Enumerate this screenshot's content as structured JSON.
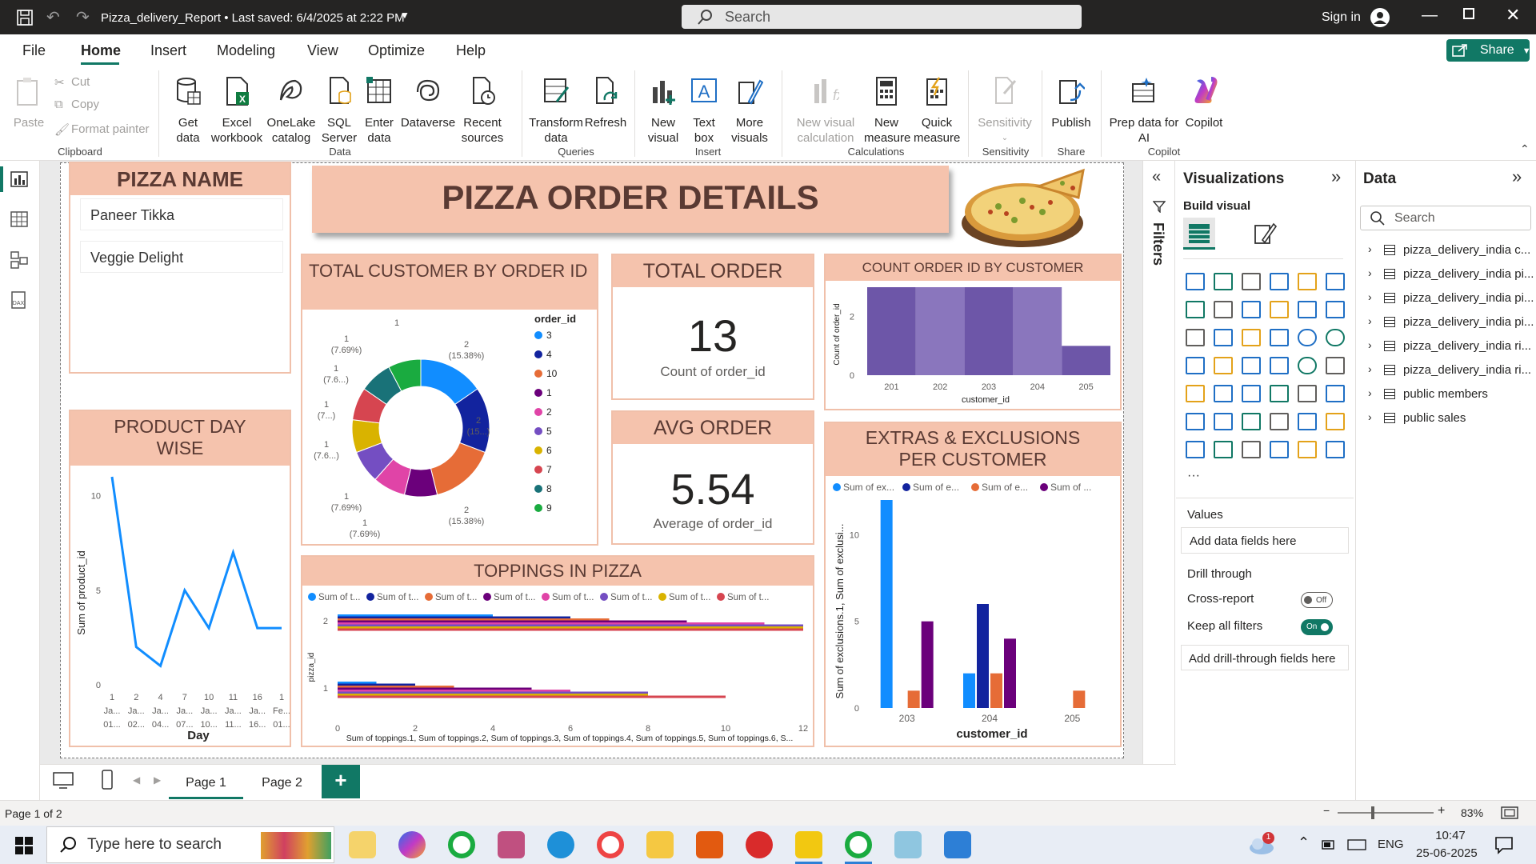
{
  "titlebar": {
    "title": "Pizza_delivery_Report • Last saved: 6/4/2025 at 2:22 PM",
    "search_placeholder": "Search",
    "signin": "Sign in"
  },
  "menu": {
    "items": [
      "File",
      "Home",
      "Insert",
      "Modeling",
      "View",
      "Optimize",
      "Help"
    ],
    "share": "Share"
  },
  "ribbon": {
    "clipboard": {
      "paste": "Paste",
      "cut": "Cut",
      "copy": "Copy",
      "format_painter": "Format painter",
      "group": "Clipboard"
    },
    "data": {
      "get_data": "Get data",
      "excel": "Excel workbook",
      "onelake": "OneLake catalog",
      "sql": "SQL Server",
      "enter": "Enter data",
      "dataverse": "Dataverse",
      "recent": "Recent sources",
      "group": "Data"
    },
    "queries": {
      "transform": "Transform data",
      "refresh": "Refresh",
      "group": "Queries"
    },
    "insert": {
      "new_visual": "New visual",
      "text_box": "Text box",
      "more_visuals": "More visuals",
      "group": "Insert"
    },
    "calculations": {
      "new_visual_calc": "New visual calculation",
      "new_measure": "New measure",
      "quick_measure": "Quick measure",
      "group": "Calculations"
    },
    "sensitivity": {
      "label": "Sensitivity",
      "group": "Sensitivity"
    },
    "share": {
      "publish": "Publish",
      "group": "Share"
    },
    "copilot": {
      "prep": "Prep data for AI",
      "copilot": "Copilot",
      "group": "Copilot"
    }
  },
  "report": {
    "title": "PIZZA ORDER DETAILS",
    "pizza_name": {
      "header": "PIZZA NAME",
      "items": [
        "Paneer Tikka",
        "Veggie Delight"
      ]
    },
    "product_day": {
      "header": "PRODUCT DAY WISE",
      "ylabel": "Sum of product_id",
      "xlabel": "Day"
    },
    "donut": {
      "header": "TOTAL CUSTOMER BY ORDER ID",
      "legend_title": "order_id"
    },
    "total_order": {
      "header": "TOTAL ORDER",
      "value": "13",
      "caption": "Count of order_id"
    },
    "avg_order": {
      "header": "AVG ORDER",
      "value": "5.54",
      "caption": "Average of order_id"
    },
    "count_by_customer": {
      "header": "COUNT ORDER ID BY CUSTOMER",
      "ylabel": "Count of order_id",
      "xlabel": "customer_id"
    },
    "extras": {
      "header": "EXTRAS & EXCLUSIONS PER CUSTOMER",
      "ylabel": "Sum of exclusions.1, Sum of exclusi...",
      "xlabel": "customer_id",
      "legend": [
        "Sum of ex...",
        "Sum of e...",
        "Sum of e...",
        "Sum of ..."
      ]
    },
    "toppings": {
      "header": "TOPPINGS IN PIZZA",
      "ylabel": "pizza_id",
      "xlabel": "Sum of toppings.1, Sum of toppings.2, Sum of toppings.3, Sum of toppings.4, Sum of toppings.5, Sum of toppings.6, S...",
      "legend": [
        "Sum of t...",
        "Sum of t...",
        "Sum of t...",
        "Sum of t...",
        "Sum of t...",
        "Sum of t...",
        "Sum of t...",
        "Sum of t..."
      ]
    }
  },
  "chart_data": [
    {
      "type": "line",
      "title": "PRODUCT DAY WISE",
      "xlabel": "Day",
      "ylabel": "Sum of product_id",
      "x": [
        "1 Ja... 01...",
        "2 Ja... 02...",
        "4 Ja... 04...",
        "7 Ja... 07...",
        "10 Ja... 10...",
        "11 Ja... 11...",
        "16 Ja... 16...",
        "1 Fe... 01..."
      ],
      "y": [
        11,
        2,
        1,
        5,
        3,
        7,
        3,
        3
      ],
      "ylim": [
        0,
        11
      ],
      "yticks": [
        0,
        5,
        10
      ],
      "color": "#118dff"
    },
    {
      "type": "pie",
      "title": "TOTAL CUSTOMER BY ORDER ID",
      "legend_title": "order_id",
      "categories": [
        "3",
        "4",
        "10",
        "1",
        "2",
        "5",
        "6",
        "7",
        "8",
        "9"
      ],
      "values": [
        2,
        2,
        2,
        1,
        1,
        1,
        1,
        1,
        1,
        1
      ],
      "labels": [
        "2 (15.38%)",
        "2 (15...)",
        "2 (15.38%)",
        "1 (7.69%)",
        "1 (7.69%)",
        "1 (7.6...)",
        "1 (7...)",
        "1 (7.6...)",
        "1 (7.69%)",
        "1"
      ],
      "colors": [
        "#118dff",
        "#12239e",
        "#e66c37",
        "#6b007b",
        "#e044a7",
        "#744ec2",
        "#d9b300",
        "#d64550",
        "#197278",
        "#1aab40"
      ]
    },
    {
      "type": "area",
      "title": "COUNT ORDER ID BY CUSTOMER",
      "xlabel": "customer_id",
      "ylabel": "Count of order_id",
      "x": [
        "201",
        "202",
        "203",
        "204",
        "205"
      ],
      "y": [
        3,
        3,
        3,
        3,
        1
      ],
      "ylim": [
        0,
        3
      ],
      "yticks": [
        0,
        2
      ],
      "color": "#6d56a8"
    },
    {
      "type": "bar",
      "title": "EXTRAS & EXCLUSIONS PER CUSTOMER",
      "xlabel": "customer_id",
      "ylabel": "Sum of exclusions.1, Sum of exclusi...",
      "categories": [
        "203",
        "204",
        "205"
      ],
      "ylim": [
        0,
        12
      ],
      "yticks": [
        0,
        5,
        10
      ],
      "series": [
        {
          "color": "#118dff",
          "values": [
            12,
            2,
            0
          ]
        },
        {
          "color": "#12239e",
          "values": [
            0,
            6,
            0
          ]
        },
        {
          "color": "#e66c37",
          "values": [
            1,
            2,
            1
          ]
        },
        {
          "color": "#6b007b",
          "values": [
            5,
            4,
            0
          ]
        }
      ]
    },
    {
      "type": "bar",
      "title": "TOPPINGS IN PIZZA",
      "orientation": "horizontal",
      "ylabel": "pizza_id",
      "categories": [
        "2",
        "1"
      ],
      "xlim": [
        0,
        12
      ],
      "xticks": [
        0,
        2,
        4,
        6,
        8,
        10,
        12
      ],
      "series": [
        {
          "color": "#118dff",
          "values": [
            4,
            1
          ]
        },
        {
          "color": "#12239e",
          "values": [
            6,
            2
          ]
        },
        {
          "color": "#e66c37",
          "values": [
            7,
            3
          ]
        },
        {
          "color": "#6b007b",
          "values": [
            9,
            5
          ]
        },
        {
          "color": "#e044a7",
          "values": [
            11,
            6
          ]
        },
        {
          "color": "#744ec2",
          "values": [
            12,
            8
          ]
        },
        {
          "color": "#d9b300",
          "values": [
            12,
            8
          ]
        },
        {
          "color": "#d64550",
          "values": [
            12,
            10
          ]
        }
      ]
    }
  ],
  "filters": {
    "label": "Filters"
  },
  "visualizations": {
    "title": "Visualizations",
    "build_visual": "Build visual",
    "values": "Values",
    "add_data": "Add data fields here",
    "drill_through": "Drill through",
    "cross_report": "Cross-report",
    "cross_report_state": "Off",
    "keep_filters": "Keep all filters",
    "keep_filters_state": "On",
    "add_drill": "Add drill-through fields here"
  },
  "data_pane": {
    "title": "Data",
    "search": "Search",
    "tables": [
      "pizza_delivery_india c...",
      "pizza_delivery_india pi...",
      "pizza_delivery_india pi...",
      "pizza_delivery_india pi...",
      "pizza_delivery_india ri...",
      "pizza_delivery_india ri...",
      "public members",
      "public sales"
    ]
  },
  "pages": {
    "tabs": [
      "Page 1",
      "Page 2"
    ],
    "add": "+"
  },
  "status": {
    "page": "Page 1 of 2",
    "zoom": "83%"
  },
  "taskbar": {
    "search": "Type here to search",
    "lang": "ENG",
    "time": "10:47",
    "date": "25-06-2025",
    "badge": "1"
  },
  "colors": {
    "accent": "#117865",
    "header_fill": "#f5c3ad",
    "header_text": "#5a3a33"
  }
}
